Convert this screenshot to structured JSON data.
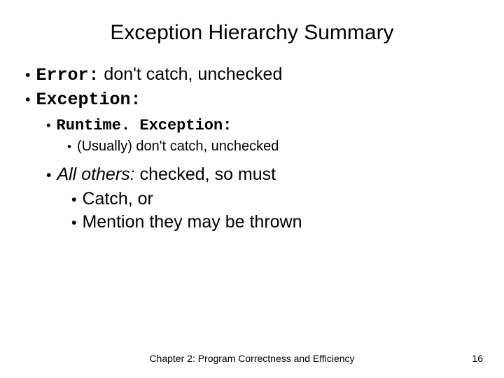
{
  "title": "Exception Hierarchy Summary",
  "bullets": {
    "error_label": "Error:",
    "error_text": " don't catch, unchecked",
    "exception_label": "Exception:",
    "runtime_label": "Runtime. Exception:",
    "runtime_sub": "(Usually) don't catch, unchecked",
    "others_label": "All others:",
    "others_text": " checked, so must",
    "catch": "Catch, or",
    "mention": "Mention they may be thrown"
  },
  "footer": "Chapter 2: Program Correctness and Efficiency",
  "page_number": "16"
}
